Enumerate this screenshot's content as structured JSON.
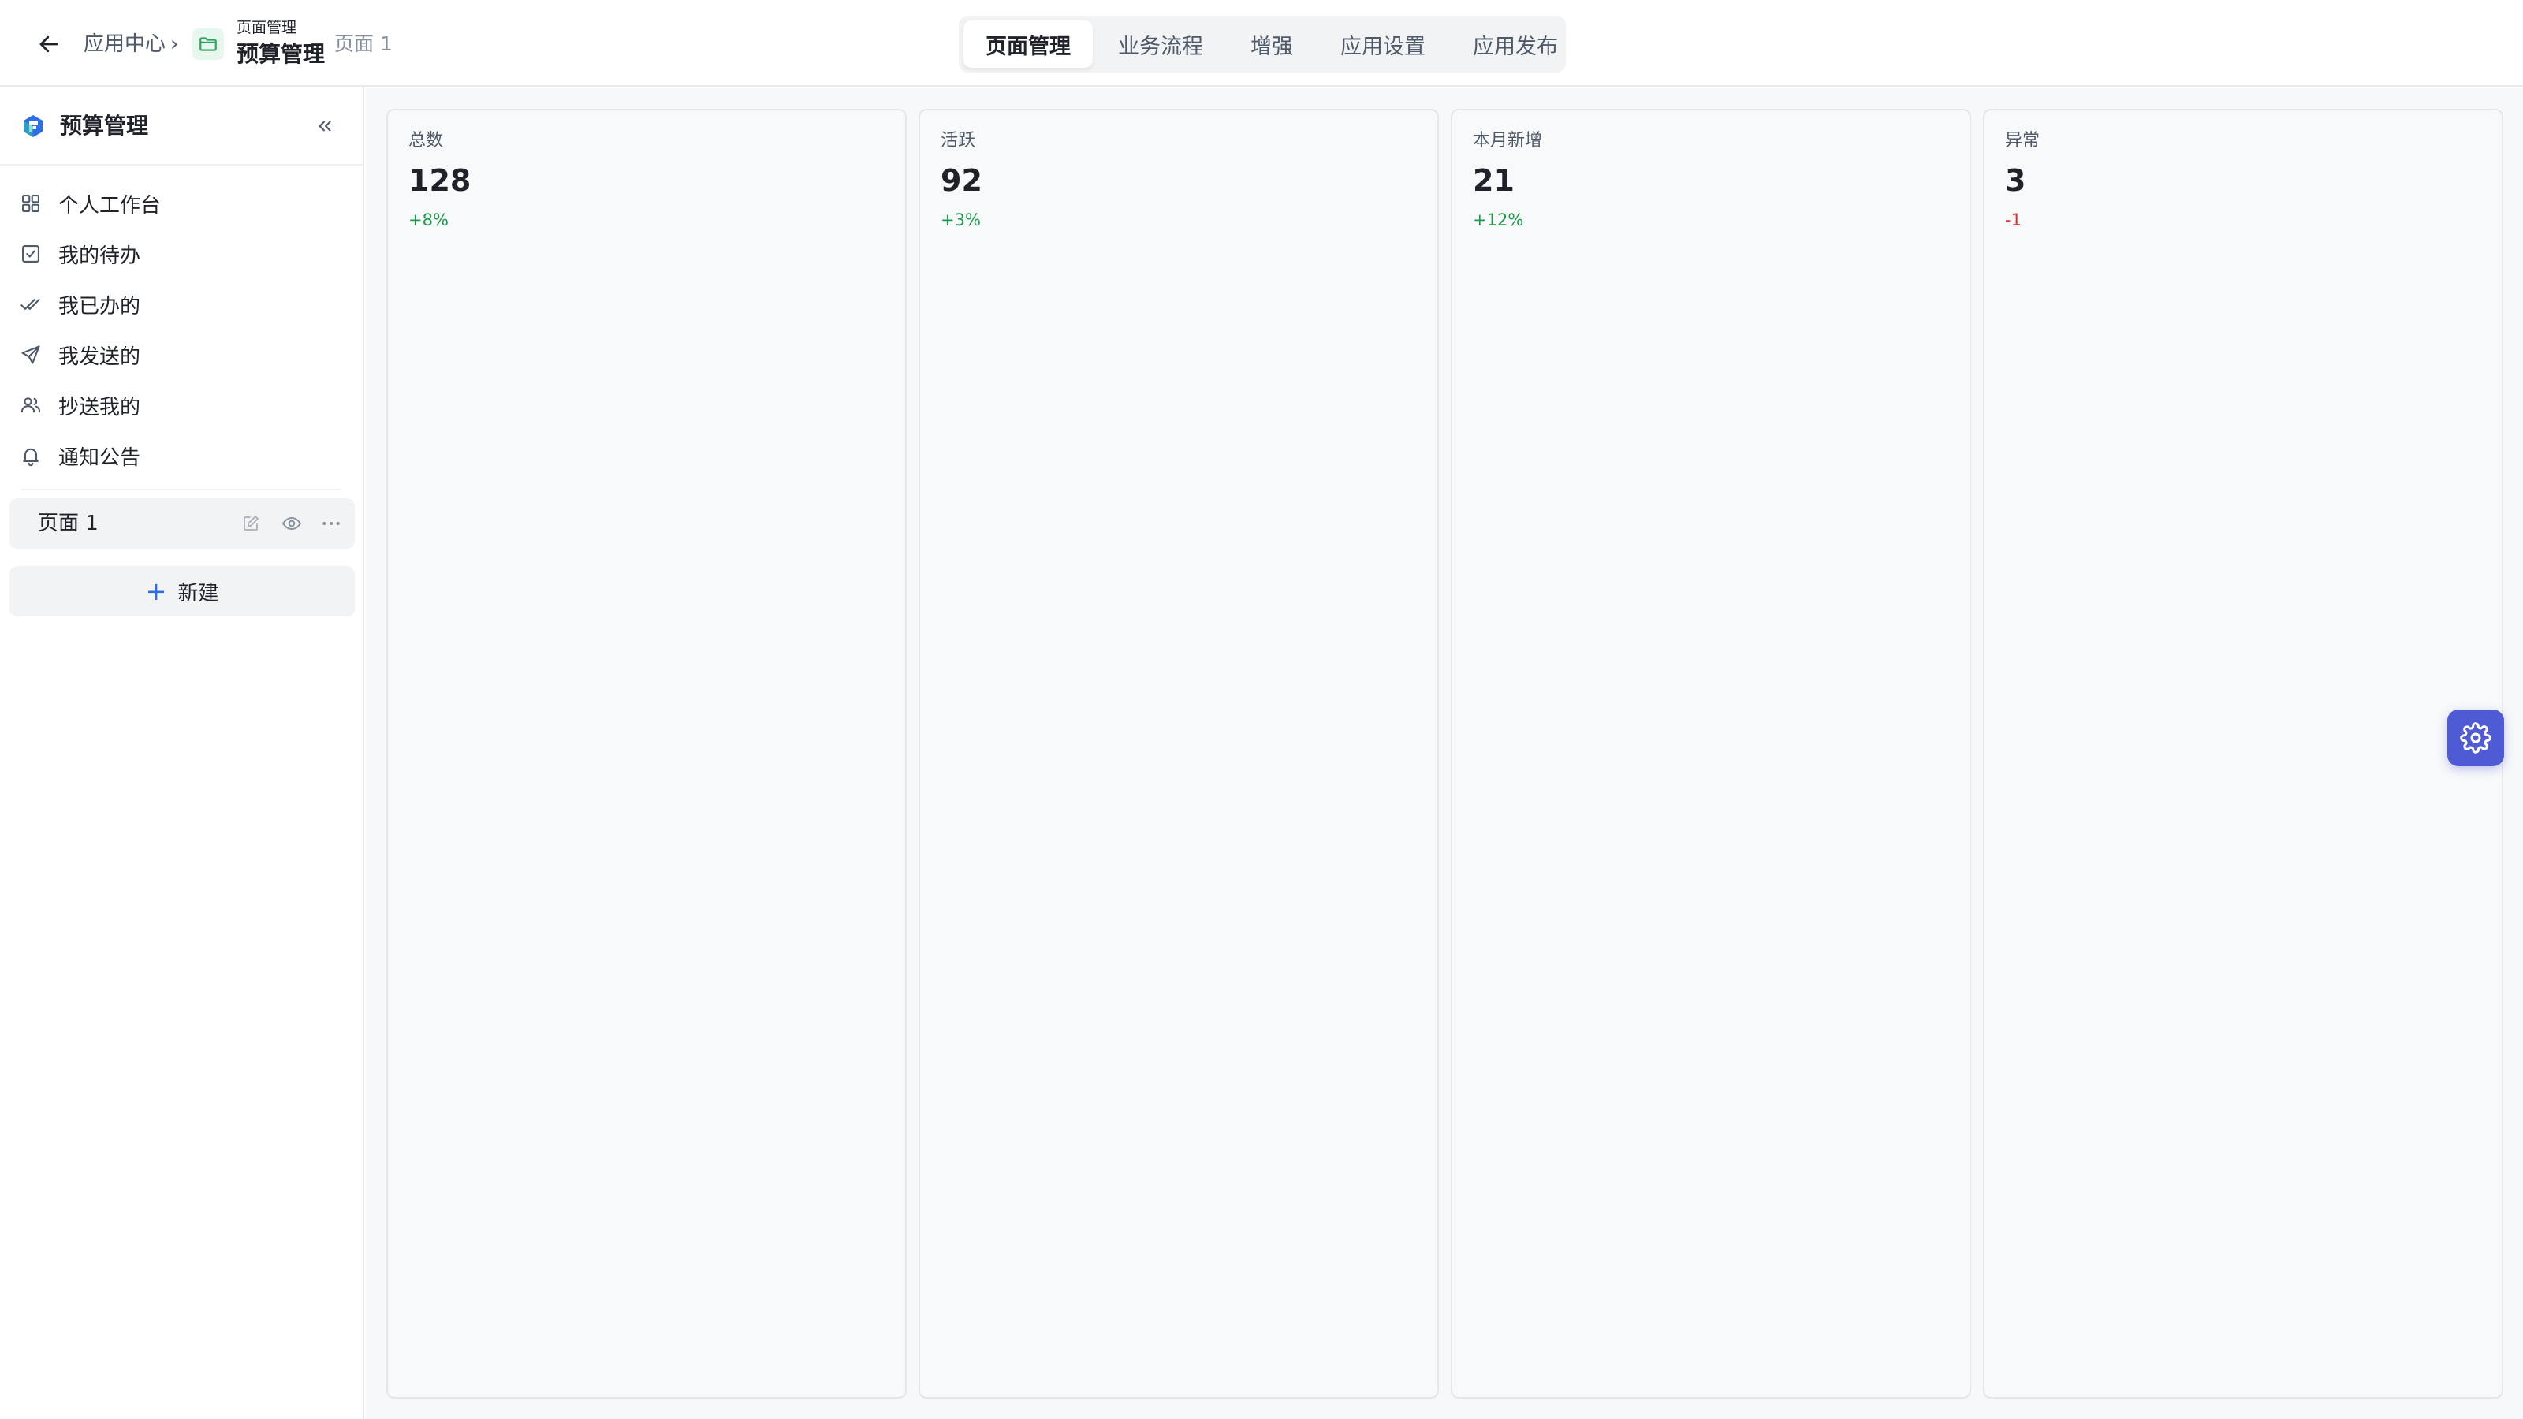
{
  "header": {
    "breadcrumb": {
      "app_center": "应用中心",
      "separator": "›",
      "section_small": "页面管理",
      "section_big": "预算管理",
      "current_page": "页面 1"
    },
    "tabs": [
      {
        "label": "页面管理",
        "active": true
      },
      {
        "label": "业务流程",
        "active": false
      },
      {
        "label": "增强",
        "active": false
      },
      {
        "label": "应用设置",
        "active": false
      },
      {
        "label": "应用发布",
        "active": false
      }
    ]
  },
  "sidebar": {
    "title": "预算管理",
    "nav": [
      {
        "label": "个人工作台",
        "icon": "grid-icon"
      },
      {
        "label": "我的待办",
        "icon": "checkbox-icon"
      },
      {
        "label": "我已办的",
        "icon": "double-check-icon"
      },
      {
        "label": "我发送的",
        "icon": "send-icon"
      },
      {
        "label": "抄送我的",
        "icon": "users-icon"
      },
      {
        "label": "通知公告",
        "icon": "bell-icon"
      }
    ],
    "pages": [
      {
        "label": "页面 1"
      }
    ],
    "new_button": {
      "plus": "+",
      "label": "新建"
    }
  },
  "stats": [
    {
      "label": "总数",
      "value": "128",
      "delta": "+8%",
      "trend": "up"
    },
    {
      "label": "活跃",
      "value": "92",
      "delta": "+3%",
      "trend": "up"
    },
    {
      "label": "本月新增",
      "value": "21",
      "delta": "+12%",
      "trend": "up"
    },
    {
      "label": "异常",
      "value": "3",
      "delta": "-1",
      "trend": "down"
    }
  ],
  "colors": {
    "up": "#1a9b4b",
    "down": "#e03131",
    "fab": "#4f5bd5",
    "accent": "#2b6ee6"
  }
}
